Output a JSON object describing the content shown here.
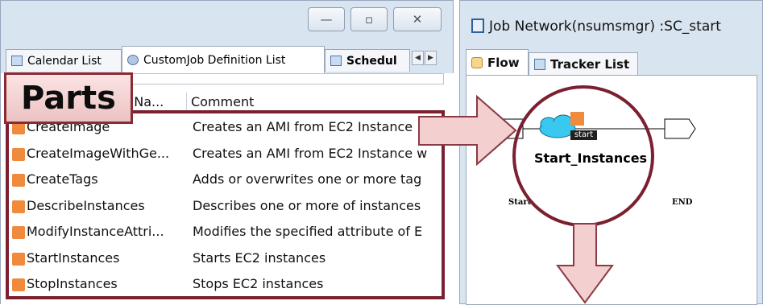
{
  "left_window": {
    "tabs": [
      {
        "label": "Calendar List"
      },
      {
        "label": "CustomJob Definition List"
      },
      {
        "label": "Schedul"
      }
    ],
    "columns": {
      "name": "n Na...",
      "comment": "Comment"
    },
    "rows": [
      {
        "name": "CreateImage",
        "comment": "Creates an AMI from EC2 Instance"
      },
      {
        "name": "CreateImageWithGe...",
        "comment": "Creates an AMI from EC2 Instance w"
      },
      {
        "name": "CreateTags",
        "comment": "Adds or overwrites one or more tag"
      },
      {
        "name": "DescribeInstances",
        "comment": "Describes one or more of instances"
      },
      {
        "name": "ModifyInstanceAttri...",
        "comment": "Modifies the specified attribute of E"
      },
      {
        "name": "StartInstances",
        "comment": "Starts EC2 instances"
      },
      {
        "name": "StopInstances",
        "comment": "Stops EC2 instances"
      }
    ],
    "window_buttons": {
      "minimize": "—",
      "restore": "▫",
      "close": "✕"
    },
    "tab_nav": {
      "prev": "◀",
      "next": "▶"
    }
  },
  "callout": {
    "label": "Parts"
  },
  "right_window": {
    "title": "Job Network(nsumsmgr) :SC_start",
    "tabs": [
      {
        "label": "Flow"
      },
      {
        "label": "Tracker List"
      }
    ],
    "flow": {
      "start_node": "Start",
      "end_node": "END",
      "job_name": "Start_Instances",
      "job_badge": "start"
    }
  },
  "colors": {
    "highlight": "#7a2030",
    "arrow_fill": "#f3cfcf",
    "arrow_stroke": "#8a3a44",
    "job_icon": "#38c8f0",
    "part_square": "#f08a3c"
  }
}
